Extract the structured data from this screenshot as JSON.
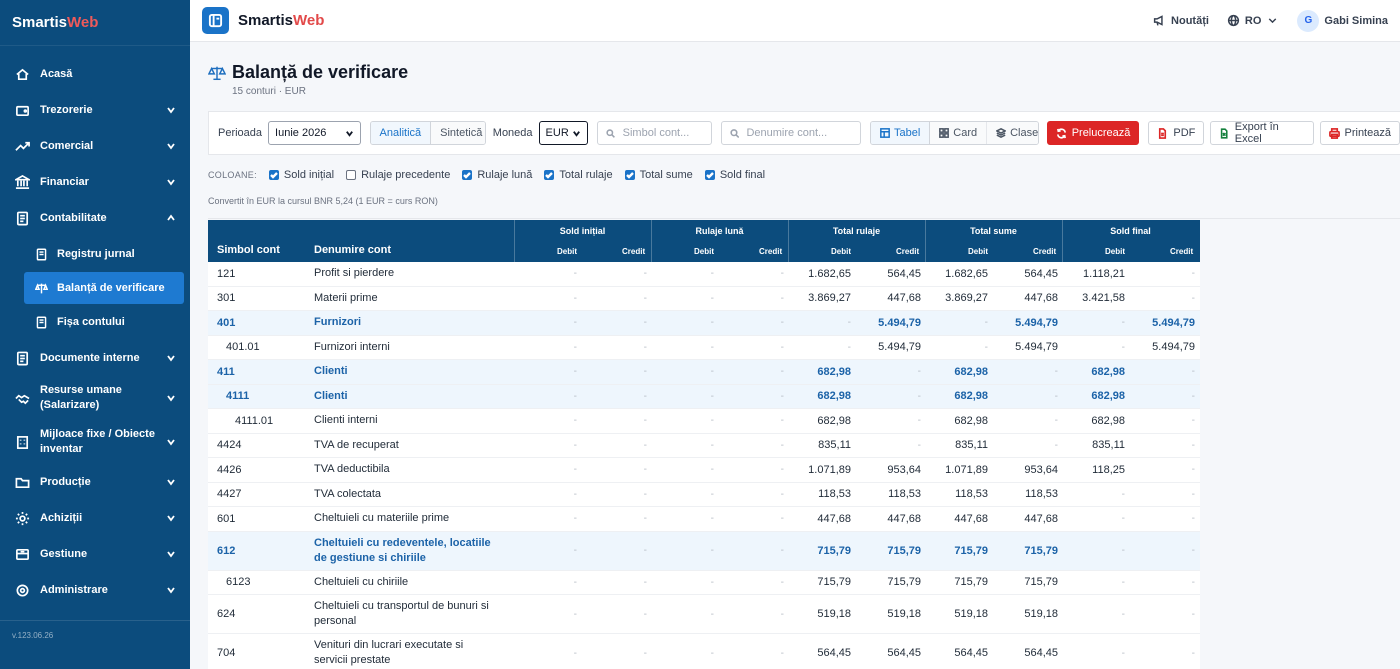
{
  "sidebar": {
    "brand_main": "Smartis",
    "brand_accent": "Web",
    "items": [
      {
        "label": "Acasă",
        "icon": "home-icon"
      },
      {
        "label": "Trezorerie",
        "icon": "wallet-icon"
      },
      {
        "label": "Comercial",
        "icon": "trend-icon"
      },
      {
        "label": "Financiar",
        "icon": "bank-icon"
      },
      {
        "label": "Contabilitate",
        "icon": "document-icon"
      },
      {
        "label": "Documente interne",
        "icon": "document-icon"
      },
      {
        "label": "Resurse umane (Salarizare)",
        "icon": "handshake-icon"
      },
      {
        "label": "Mijloace fixe / Obiecte inventar",
        "icon": "building-icon"
      },
      {
        "label": "Producție",
        "icon": "folder-icon"
      },
      {
        "label": "Achiziții",
        "icon": "gear-icon"
      },
      {
        "label": "Gestiune",
        "icon": "inventory-icon"
      },
      {
        "label": "Administrare",
        "icon": "settings-icon"
      }
    ],
    "subitems": [
      {
        "label": "Registru jurnal"
      },
      {
        "label": "Balanță de verificare"
      },
      {
        "label": "Fișa contului"
      }
    ],
    "version": "v.123.06.26"
  },
  "topbar": {
    "brand_main": "Smartis",
    "brand_accent": "Web",
    "news": "Noutăți",
    "lang": "RO",
    "avatar_initial": "G",
    "user": "Gabi Simina"
  },
  "page": {
    "title": "Balanță de verificare",
    "subtitle": "15 conturi · EUR"
  },
  "toolbar": {
    "period_label": "Perioada",
    "period_value": "Iunie 2026",
    "analytic": "Analitică",
    "synthetic": "Sintetică",
    "currency_label": "Moneda",
    "currency_value": "EUR",
    "symbol_placeholder": "Simbol cont...",
    "name_placeholder": "Denumire cont...",
    "view_table": "Tabel",
    "view_card": "Card",
    "view_classes": "Clase",
    "process": "Prelucrează",
    "pdf": "PDF",
    "excel": "Export în Excel",
    "print": "Printează"
  },
  "columns": {
    "caption": "COLOANE:",
    "items": [
      {
        "label": "Sold inițial",
        "checked": true
      },
      {
        "label": "Rulaje precedente",
        "checked": false
      },
      {
        "label": "Rulaje lună",
        "checked": true
      },
      {
        "label": "Total rulaje",
        "checked": true
      },
      {
        "label": "Total sume",
        "checked": true
      },
      {
        "label": "Sold final",
        "checked": true
      }
    ],
    "conversion_note": "Convertit în EUR la cursul BNR 5,24 (1 EUR = curs RON)"
  },
  "table": {
    "col_symbol": "Simbol cont",
    "col_name": "Denumire cont",
    "groups": [
      "Sold inițial",
      "Rulaje lună",
      "Total rulaje",
      "Total sume",
      "Sold final"
    ],
    "debit": "Debit",
    "credit": "Credit",
    "dash": "-",
    "rows": [
      {
        "symbol": "121",
        "name": "Profit si pierdere",
        "indent": 0,
        "hl": false,
        "vals": [
          "-",
          "-",
          "-",
          "-",
          "1.682,65",
          "564,45",
          "1.682,65",
          "564,45",
          "1.118,21",
          "-"
        ]
      },
      {
        "symbol": "301",
        "name": "Materii prime",
        "indent": 0,
        "hl": false,
        "vals": [
          "-",
          "-",
          "-",
          "-",
          "3.869,27",
          "447,68",
          "3.869,27",
          "447,68",
          "3.421,58",
          "-"
        ]
      },
      {
        "symbol": "401",
        "name": "Furnizori",
        "indent": 0,
        "hl": true,
        "vals": [
          "-",
          "-",
          "-",
          "-",
          "-",
          "5.494,79",
          "-",
          "5.494,79",
          "-",
          "5.494,79"
        ]
      },
      {
        "symbol": "401.01",
        "name": "Furnizori interni",
        "indent": 1,
        "hl": false,
        "vals": [
          "-",
          "-",
          "-",
          "-",
          "-",
          "5.494,79",
          "-",
          "5.494,79",
          "-",
          "5.494,79"
        ]
      },
      {
        "symbol": "411",
        "name": "Clienti",
        "indent": 0,
        "hl": true,
        "vals": [
          "-",
          "-",
          "-",
          "-",
          "682,98",
          "-",
          "682,98",
          "-",
          "682,98",
          "-"
        ]
      },
      {
        "symbol": "4111",
        "name": "Clienti",
        "indent": 1,
        "hl": true,
        "vals": [
          "-",
          "-",
          "-",
          "-",
          "682,98",
          "-",
          "682,98",
          "-",
          "682,98",
          "-"
        ]
      },
      {
        "symbol": "4111.01",
        "name": "Clienti interni",
        "indent": 2,
        "hl": false,
        "vals": [
          "-",
          "-",
          "-",
          "-",
          "682,98",
          "-",
          "682,98",
          "-",
          "682,98",
          "-"
        ]
      },
      {
        "symbol": "4424",
        "name": "TVA de recuperat",
        "indent": 0,
        "hl": false,
        "vals": [
          "-",
          "-",
          "-",
          "-",
          "835,11",
          "-",
          "835,11",
          "-",
          "835,11",
          "-"
        ]
      },
      {
        "symbol": "4426",
        "name": "TVA deductibila",
        "indent": 0,
        "hl": false,
        "vals": [
          "-",
          "-",
          "-",
          "-",
          "1.071,89",
          "953,64",
          "1.071,89",
          "953,64",
          "118,25",
          "-"
        ]
      },
      {
        "symbol": "4427",
        "name": "TVA colectata",
        "indent": 0,
        "hl": false,
        "vals": [
          "-",
          "-",
          "-",
          "-",
          "118,53",
          "118,53",
          "118,53",
          "118,53",
          "-",
          "-"
        ]
      },
      {
        "symbol": "601",
        "name": "Cheltuieli cu materiile prime",
        "indent": 0,
        "hl": false,
        "vals": [
          "-",
          "-",
          "-",
          "-",
          "447,68",
          "447,68",
          "447,68",
          "447,68",
          "-",
          "-"
        ]
      },
      {
        "symbol": "612",
        "name": "Cheltuieli cu redeventele, locatiile de gestiune si chiriile",
        "indent": 0,
        "hl": true,
        "vals": [
          "-",
          "-",
          "-",
          "-",
          "715,79",
          "715,79",
          "715,79",
          "715,79",
          "-",
          "-"
        ]
      },
      {
        "symbol": "6123",
        "name": "Cheltuieli cu chiriile",
        "indent": 1,
        "hl": false,
        "vals": [
          "-",
          "-",
          "-",
          "-",
          "715,79",
          "715,79",
          "715,79",
          "715,79",
          "-",
          "-"
        ]
      },
      {
        "symbol": "624",
        "name": "Cheltuieli cu transportul de bunuri si personal",
        "indent": 0,
        "hl": false,
        "vals": [
          "-",
          "-",
          "-",
          "-",
          "519,18",
          "519,18",
          "519,18",
          "519,18",
          "-",
          "-"
        ]
      },
      {
        "symbol": "704",
        "name": "Venituri din lucrari executate si servicii prestate",
        "indent": 0,
        "hl": false,
        "vals": [
          "-",
          "-",
          "-",
          "-",
          "564,45",
          "564,45",
          "564,45",
          "564,45",
          "-",
          "-"
        ]
      }
    ]
  },
  "colors": {
    "sidebar": "#0c4c7d",
    "active": "#1e7ad1",
    "primary_button": "#dc2626",
    "highlight_row": "#eef6fd"
  }
}
